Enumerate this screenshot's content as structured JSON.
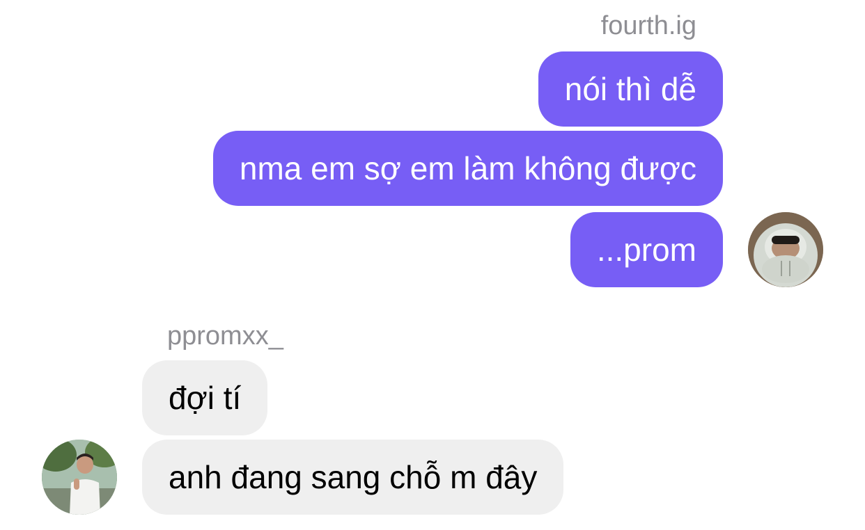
{
  "conversation": {
    "outgoing": {
      "sender": "fourth.ig",
      "messages": [
        "nói thì dễ",
        "nma em sợ em làm không được",
        "...prom"
      ],
      "bubble_color": "#775ef5",
      "text_color": "#ffffff"
    },
    "incoming": {
      "sender": "ppromxx_",
      "messages": [
        "đợi tí",
        "anh đang sang chỗ m đây"
      ],
      "bubble_color": "#efefef",
      "text_color": "#000000"
    },
    "name_color": "#8e8e93"
  }
}
